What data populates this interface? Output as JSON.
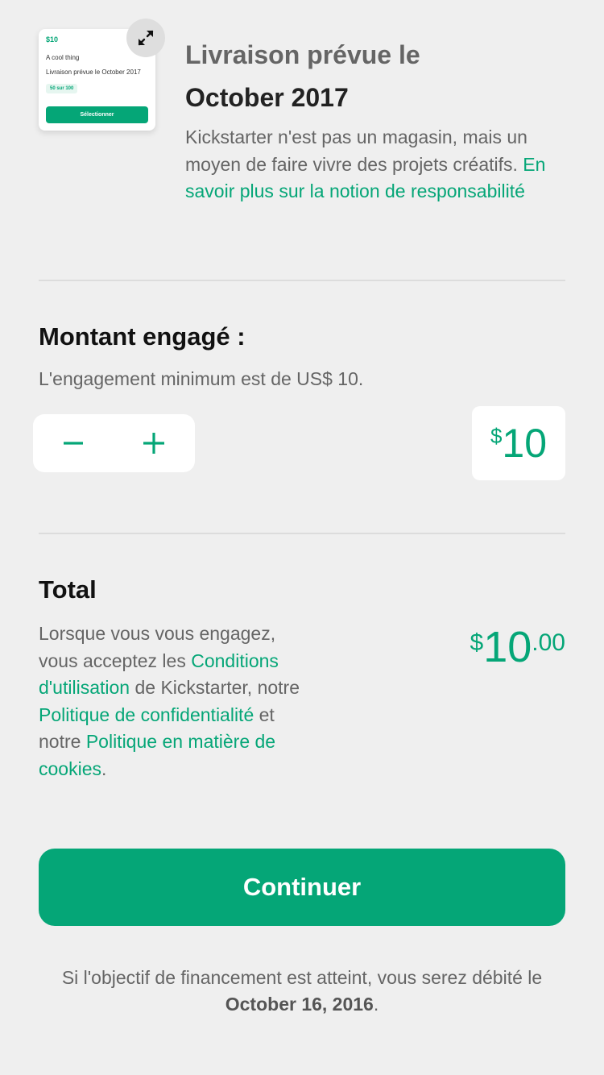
{
  "reward_card": {
    "amount": "$10",
    "title": "A cool thing",
    "delivery": "Livraison prévue le October 2017",
    "badge": "50 sur 100",
    "select_label": "Sélectionner"
  },
  "icons": {
    "expand": "expand-arrows-icon",
    "minus": "minus-icon",
    "plus": "plus-icon"
  },
  "delivery": {
    "label": "Livraison prévue le",
    "date": "October 2017",
    "description": "Kickstarter n'est pas un magasin, mais un moyen de faire vivre des projets créatifs.",
    "link": "En savoir plus sur la notion de responsabilité"
  },
  "pledge": {
    "heading": "Montant engagé :",
    "minimum": "L'engagement minimum est de US$ 10.",
    "currency": "$",
    "amount": "10"
  },
  "total": {
    "heading": "Total",
    "currency": "$",
    "integer": "10",
    "decimal": ".00",
    "terms_1": "Lorsque vous vous engagez, vous acceptez les",
    "terms_link_1": "Conditions d'utilisation",
    "terms_2": "de Kickstarter, notre",
    "terms_link_2": "Politique de confidentialité",
    "terms_3": "et notre",
    "terms_link_3": "Politique en matière de cookies",
    "terms_4": "."
  },
  "cta": {
    "label": "Continuer"
  },
  "footnote": {
    "text": "Si l'objectif de financement est atteint, vous serez débité le",
    "date": "October 16, 2016",
    "end": "."
  },
  "colors": {
    "accent": "#05a677",
    "background": "#efefef",
    "text_secondary": "#656565"
  }
}
